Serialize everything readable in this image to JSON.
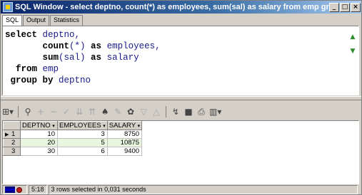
{
  "window": {
    "title": "SQL Window - select deptno, count(*) as employees, sum(sal) as salary from emp group b...",
    "controls": {
      "minimize": "_",
      "maximize": "□",
      "close": "×"
    }
  },
  "tabs": [
    {
      "label": "SQL",
      "active": true
    },
    {
      "label": "Output",
      "active": false
    },
    {
      "label": "Statistics",
      "active": false
    }
  ],
  "editor": {
    "lines": [
      [
        {
          "t": "select",
          "k": "kw"
        },
        {
          "t": " deptno,",
          "k": "plain"
        }
      ],
      [
        {
          "t": "       ",
          "k": "plain"
        },
        {
          "t": "count",
          "k": "kw"
        },
        {
          "t": "(*) ",
          "k": "plain"
        },
        {
          "t": "as",
          "k": "kw"
        },
        {
          "t": " employees,",
          "k": "plain"
        }
      ],
      [
        {
          "t": "       ",
          "k": "plain"
        },
        {
          "t": "sum",
          "k": "kw"
        },
        {
          "t": "(sal) ",
          "k": "plain"
        },
        {
          "t": "as",
          "k": "kw"
        },
        {
          "t": " salary",
          "k": "plain"
        }
      ],
      [
        {
          "t": "  ",
          "k": "plain"
        },
        {
          "t": "from",
          "k": "kw"
        },
        {
          "t": " emp",
          "k": "plain"
        }
      ],
      [
        {
          "t": " ",
          "k": "plain"
        },
        {
          "t": "group by",
          "k": "kw"
        },
        {
          "t": " deptno",
          "k": "plain"
        }
      ]
    ],
    "side_icons": [
      "up-arrow-icon",
      "down-arrow-icon"
    ]
  },
  "toolbar": {
    "items": [
      {
        "name": "grid-menu-icon",
        "glyph": "⊞▾",
        "dim": false
      },
      {
        "name": "sep",
        "glyph": "",
        "dim": false
      },
      {
        "name": "lock-icon",
        "glyph": "⚲",
        "dim": false
      },
      {
        "name": "add-row-icon",
        "glyph": "+",
        "dim": true
      },
      {
        "name": "delete-row-icon",
        "glyph": "−",
        "dim": true
      },
      {
        "name": "post-changes-icon",
        "glyph": "✓",
        "dim": true
      },
      {
        "name": "filter-down-icon",
        "glyph": "⇊",
        "dim": true
      },
      {
        "name": "filter-up-icon",
        "glyph": "⇈",
        "dim": true
      },
      {
        "name": "find-icon",
        "glyph": "♠",
        "dim": false
      },
      {
        "name": "clear-icon",
        "glyph": "✎",
        "dim": true
      },
      {
        "name": "query-by-example-icon",
        "glyph": "✿",
        "dim": false
      },
      {
        "name": "filter-icon",
        "glyph": "▽",
        "dim": true
      },
      {
        "name": "clear-filter-icon",
        "glyph": "△",
        "dim": true
      },
      {
        "name": "sep",
        "glyph": "",
        "dim": false
      },
      {
        "name": "chart-icon",
        "glyph": "↯",
        "dim": false
      },
      {
        "name": "save-icon",
        "glyph": "■",
        "dim": false
      },
      {
        "name": "print-icon",
        "glyph": "⎙",
        "dim": false
      },
      {
        "name": "export-icon",
        "glyph": "▥▾",
        "dim": false
      }
    ]
  },
  "results": {
    "columns": [
      "DEPTNO",
      "EMPLOYEES",
      "SALARY"
    ],
    "rows": [
      {
        "num": "1",
        "current": true,
        "cells": [
          "10",
          "3",
          "8750"
        ]
      },
      {
        "num": "2",
        "current": false,
        "cells": [
          "20",
          "5",
          "10875"
        ]
      },
      {
        "num": "3",
        "current": false,
        "cells": [
          "30",
          "6",
          "9400"
        ]
      }
    ]
  },
  "status": {
    "cursor": "5:18",
    "message": "3 rows selected in 0,031 seconds"
  },
  "colors": {
    "keyword": "#000000",
    "identifier": "#1a1a8a",
    "alt_row": "#e8f6e0"
  }
}
